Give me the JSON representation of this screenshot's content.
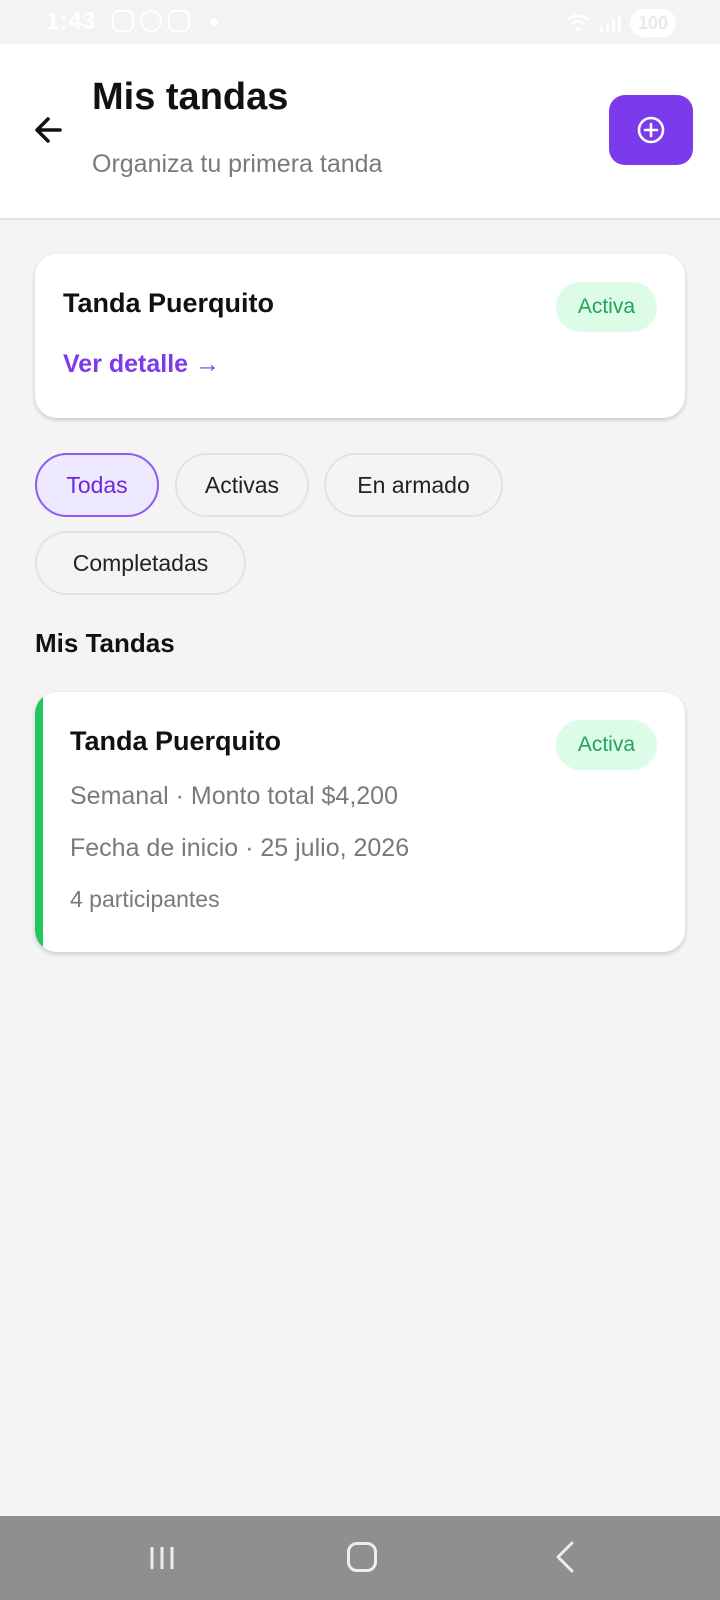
{
  "status_bar": {
    "time": "1:43",
    "battery": "100"
  },
  "header": {
    "title": "Mis tandas",
    "subtitle": "Organiza tu primera tanda",
    "add_icon": "plus-circle-icon",
    "back_icon": "arrow-left-icon"
  },
  "featured": {
    "title": "Tanda Puerquito",
    "status": "Activa",
    "link": "Ver detalle →"
  },
  "filters": [
    {
      "label": "Todas",
      "selected": true
    },
    {
      "label": "Activas",
      "selected": false
    },
    {
      "label": "En armado",
      "selected": false
    },
    {
      "label": "Completadas",
      "selected": false
    }
  ],
  "section": {
    "title": "Mis Tandas"
  },
  "tandas": [
    {
      "title": "Tanda Puerquito",
      "status": "Activa",
      "frequency_amount": "Semanal · Monto total $4,200",
      "start_date": "Fecha de inicio · 25 julio, 2026",
      "participants": "4 participantes"
    }
  ],
  "colors": {
    "accent": "#7c3aed",
    "active_green": "#22c55e",
    "badge_bg": "#dcfce7",
    "badge_text": "#22a35a"
  }
}
